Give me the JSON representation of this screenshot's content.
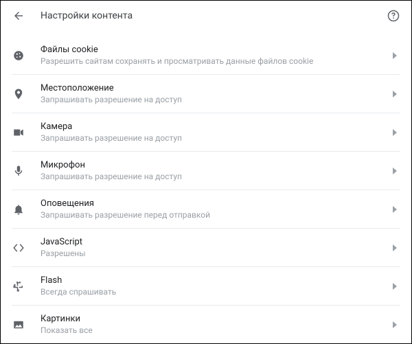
{
  "header": {
    "title": "Настройки контента"
  },
  "items": [
    {
      "icon": "cookie-icon",
      "title": "Файлы cookie",
      "sub": "Разрешить сайтам сохранять и просматривать данные файлов cookie"
    },
    {
      "icon": "location-icon",
      "title": "Местоположение",
      "sub": "Запрашивать разрешение на доступ"
    },
    {
      "icon": "camera-icon",
      "title": "Камера",
      "sub": "Запрашивать разрешение на доступ"
    },
    {
      "icon": "microphone-icon",
      "title": "Микрофон",
      "sub": "Запрашивать разрешение на доступ"
    },
    {
      "icon": "notifications-icon",
      "title": "Оповещения",
      "sub": "Запрашивать разрешение перед отправкой"
    },
    {
      "icon": "javascript-icon",
      "title": "JavaScript",
      "sub": "Разрешены"
    },
    {
      "icon": "flash-icon",
      "title": "Flash",
      "sub": "Всегда спрашивать"
    },
    {
      "icon": "images-icon",
      "title": "Картинки",
      "sub": "Показать все"
    }
  ]
}
